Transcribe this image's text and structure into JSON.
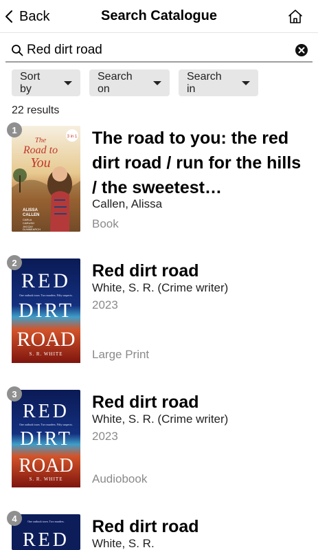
{
  "nav": {
    "back_label": "Back",
    "title": "Search Catalogue",
    "home_icon": "home-icon"
  },
  "search": {
    "value": "Red dirt road",
    "icons": {
      "search": "magnifier-icon",
      "clear": "clear-circle-icon"
    }
  },
  "filters": [
    {
      "label": "Sort by"
    },
    {
      "label": "Search on"
    },
    {
      "label": "Search in"
    }
  ],
  "results_count": "22 results",
  "results": [
    {
      "index": "1",
      "title": "The road to you: the red dirt road / run for the hills / the sweetest…",
      "author": "Callen, Alissa",
      "year": "",
      "format": "Book",
      "cover": {
        "title_line1": "The",
        "title_line2": "Road to",
        "title_line3": "You",
        "sticker": "3 in 1",
        "authors": [
          "ALISSA",
          "CALLEN",
          "CARLA",
          "CARUSO",
          "JACQUI",
          "DUNMEARCH"
        ]
      }
    },
    {
      "index": "2",
      "title": "Red dirt road",
      "author": "White, S. R. (Crime writer)",
      "year": "2023",
      "format": "Large Print",
      "cover": {
        "words": [
          "RED",
          "DIRT",
          "ROAD"
        ],
        "author": "S. R. WHITE",
        "tagline": "One outback town. Two murders. Fifty suspects."
      }
    },
    {
      "index": "3",
      "title": "Red dirt road",
      "author": "White, S. R. (Crime writer)",
      "year": "2023",
      "format": "Audiobook",
      "cover": {
        "words": [
          "RED",
          "DIRT",
          "ROAD"
        ],
        "author": "S. R. WHITE",
        "tagline": "One outback town. Two murders. Fifty suspects."
      }
    },
    {
      "index": "4",
      "title": "Red dirt road",
      "author": "White, S. R.",
      "year": "",
      "format": "",
      "cover": {
        "words": [
          "RED"
        ],
        "tagline": "One outback town. Two murders."
      }
    }
  ]
}
